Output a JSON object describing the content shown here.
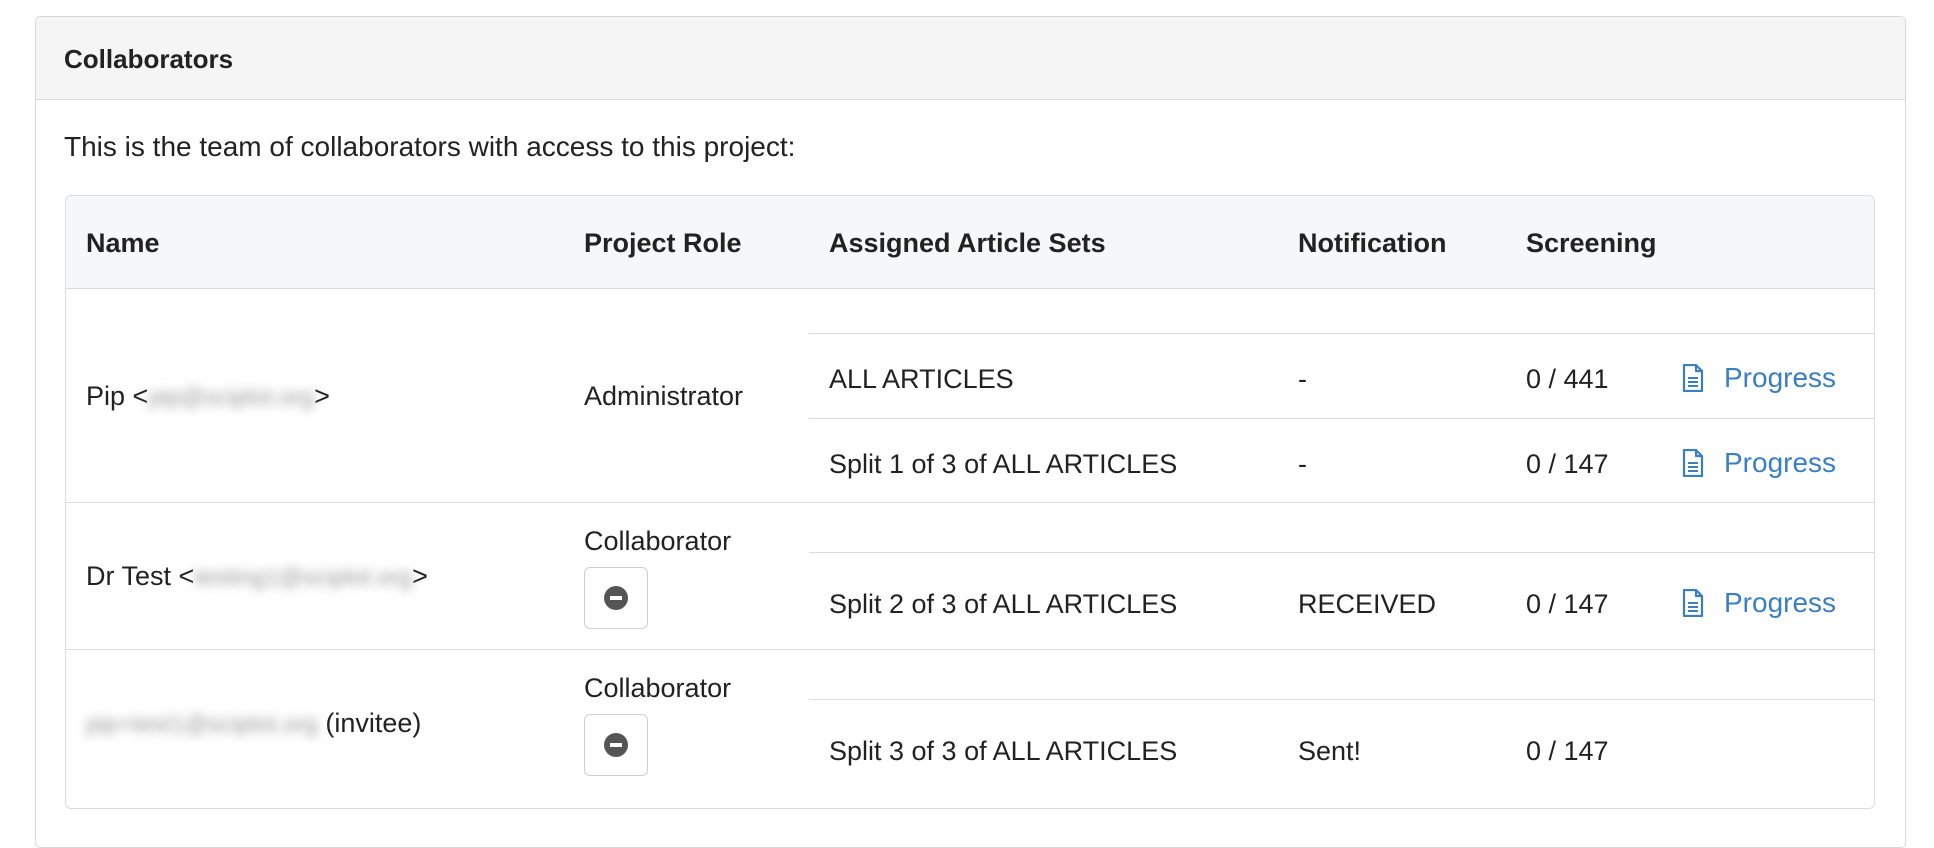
{
  "panel": {
    "title": "Collaborators",
    "intro": "This is the team of collaborators with access to this project:"
  },
  "table": {
    "headers": [
      "Name",
      "Project Role",
      "Assigned Article Sets",
      "Notification",
      "Screening"
    ],
    "rows": [
      {
        "name": "Pip",
        "email": "pip@sciplot.org",
        "role": "Administrator",
        "sets": [
          {
            "set": "ALL ARTICLES",
            "notification": "-",
            "screening": "0 / 441",
            "link": "Progress"
          },
          {
            "set": "Split 1 of 3 of ALL ARTICLES",
            "notification": "-",
            "screening": "0 / 147",
            "link": "Progress"
          }
        ]
      },
      {
        "name": "Dr Test",
        "email": "testing1@sciplot.org",
        "role": "Collaborator",
        "sets": [
          {
            "set": "Split 2 of 3 of ALL ARTICLES",
            "notification": "RECEIVED",
            "screening": "0 / 147",
            "link": "Progress"
          }
        ]
      },
      {
        "email": "pip+test1@sciplot.org",
        "suffix": "(invitee)",
        "role": "Collaborator",
        "sets": [
          {
            "set": "Split 3 of 3 of ALL ARTICLES",
            "notification": "Sent!",
            "screening": "0 / 147"
          }
        ]
      }
    ]
  },
  "colors": {
    "link": "#3a7fc1",
    "header_bg": "#f5f5f5",
    "border": "#dcdcdc"
  }
}
